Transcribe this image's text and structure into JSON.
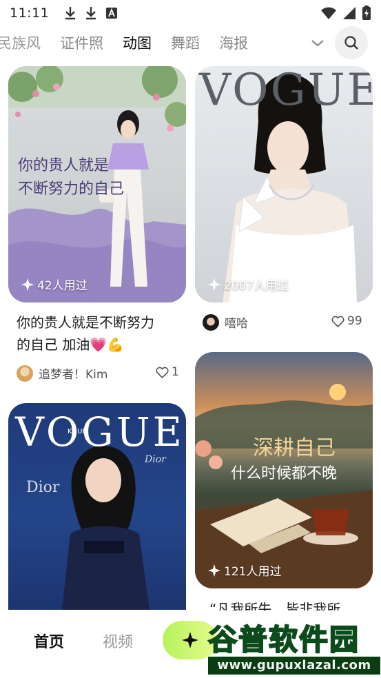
{
  "status_bar": {
    "time": "11:11",
    "left_icons": [
      "download-icon",
      "download-icon",
      "font-a-icon"
    ],
    "right_icons": [
      "wifi-icon",
      "signal-icon",
      "battery-icon"
    ]
  },
  "category_tabs": {
    "items": [
      {
        "label": "民族风"
      },
      {
        "label": "证件照"
      },
      {
        "label": "动图",
        "active": true
      },
      {
        "label": "舞蹈"
      },
      {
        "label": "海报"
      }
    ],
    "expand_icon": "chevron-down-icon",
    "search_icon": "search-icon",
    "active_highlight_color": "#c8f56a"
  },
  "feed": {
    "left": [
      {
        "image_text": [
          "你的贵人就是",
          "不断努力的自己"
        ],
        "usage": "42人用过",
        "caption_lines": [
          "你的贵人就是不断努力",
          "的自己 加油💗💪"
        ],
        "author": "追梦者！Kim",
        "likes": "1"
      },
      {
        "image_text": [
          "VOGUE",
          "KHUF",
          "Dior",
          "Dior"
        ],
        "usage": "",
        "caption_lines": [],
        "author": "",
        "likes": ""
      }
    ],
    "right": [
      {
        "image_text": [
          "VOGUE"
        ],
        "usage": "2007人用过",
        "caption_lines": [],
        "author": "嘻哈",
        "likes": "99"
      },
      {
        "image_text": [
          "深耕自己",
          "什么时候都不晚"
        ],
        "usage": "121人用过",
        "caption_lines": [
          "“凡我所失，皆非我所"
        ],
        "author": "",
        "likes": ""
      }
    ]
  },
  "bottom_nav": {
    "home": "首页",
    "video": "视频",
    "create_icon": "sparkle-icon"
  },
  "watermark": {
    "title": "谷普软件园",
    "url": "www.gupuxlazal.com"
  }
}
